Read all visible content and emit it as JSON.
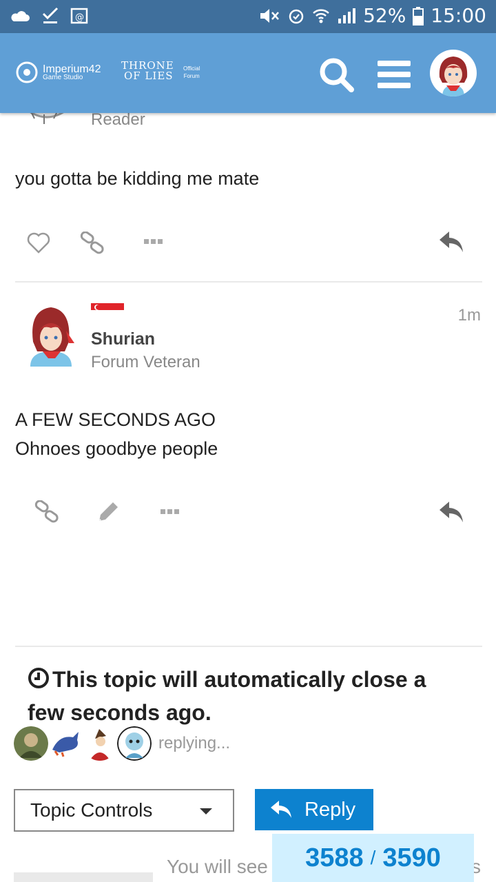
{
  "status_bar": {
    "battery": "52%",
    "time": "15:00"
  },
  "header": {
    "logo_brand": "Imperium42",
    "logo_sub": "Game Studio",
    "logo_game_line1": "THRONE",
    "logo_game_line2": "OF LIES",
    "logo_official_line1": "Official",
    "logo_official_line2": "Forum"
  },
  "previous_post": {
    "author_title": "Reader",
    "body": "you gotta be kidding me mate"
  },
  "post": {
    "author_name": "Shurian",
    "author_title": "Forum Veteran",
    "time": "1m",
    "body_line1": "A FEW SECONDS AGO",
    "body_line2": "Ohnoes goodbye people"
  },
  "notice": {
    "text": "This topic will automatically close a few seconds ago."
  },
  "replying": {
    "text": "replying..."
  },
  "controls": {
    "topic_controls_label": "Topic Controls",
    "reply_label": "Reply"
  },
  "footer": {
    "you_will_see": "You will see",
    "tail": "s"
  },
  "progress": {
    "current": "3588",
    "separator": "/",
    "total": "3590"
  },
  "colors": {
    "status_bar": "#3f6f9c",
    "header": "#5f9fd6",
    "primary": "#0d82cf",
    "progress_bg": "#d1f0ff"
  }
}
